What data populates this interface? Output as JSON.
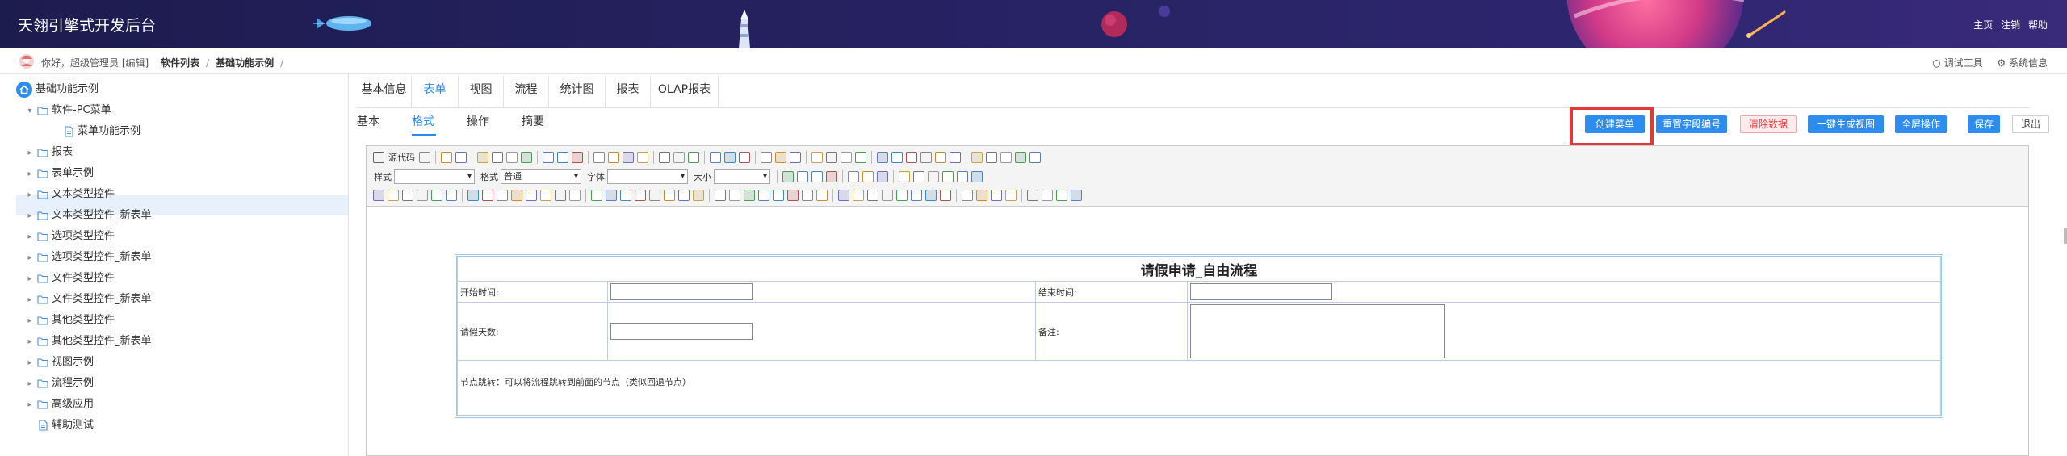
{
  "header": {
    "title": "天翎引擎式开发后台",
    "links": [
      "主页",
      "注销",
      "帮助"
    ]
  },
  "crumb": {
    "greeting": "你好，超级管理员 [编辑]",
    "path": [
      "软件列表",
      "基础功能示例"
    ],
    "sep": "/",
    "right": [
      "调试工具",
      "系统信息"
    ]
  },
  "sidebar": {
    "root": "基础功能示例",
    "items": [
      {
        "label": "软件-PC菜单",
        "icon": "folder-icon",
        "arrow": "▾"
      },
      {
        "label": "菜单功能示例",
        "icon": "file-icon",
        "arrow": ""
      },
      {
        "label": "报表",
        "icon": "folder-icon",
        "arrow": "▸"
      },
      {
        "label": "表单示例",
        "icon": "folder-icon",
        "arrow": "▸"
      },
      {
        "label": "文本类型控件",
        "icon": "folder-icon",
        "arrow": "▸"
      },
      {
        "label": "文本类型控件_新表单",
        "icon": "folder-icon",
        "arrow": "▸"
      },
      {
        "label": "选项类型控件",
        "icon": "folder-icon",
        "arrow": "▸"
      },
      {
        "label": "选项类型控件_新表单",
        "icon": "folder-icon",
        "arrow": "▸"
      },
      {
        "label": "文件类型控件",
        "icon": "folder-icon",
        "arrow": "▸"
      },
      {
        "label": "文件类型控件_新表单",
        "icon": "folder-icon",
        "arrow": "▸"
      },
      {
        "label": "其他类型控件",
        "icon": "folder-icon",
        "arrow": "▸"
      },
      {
        "label": "其他类型控件_新表单",
        "icon": "folder-icon",
        "arrow": "▸"
      },
      {
        "label": "视图示例",
        "icon": "folder-icon",
        "arrow": "▸"
      },
      {
        "label": "流程示例",
        "icon": "folder-icon",
        "arrow": "▸"
      },
      {
        "label": "高级应用",
        "icon": "folder-icon",
        "arrow": "▸"
      },
      {
        "label": "辅助测试",
        "icon": "file-icon",
        "arrow": ""
      }
    ]
  },
  "tabs": [
    "基本信息",
    "表单",
    "视图",
    "流程",
    "统计图",
    "报表",
    "OLAP报表"
  ],
  "subtabs": [
    "基本",
    "格式",
    "操作",
    "摘要"
  ],
  "buttons": {
    "create_menu": "创建菜单",
    "reset_field": "重置字段编号",
    "clear_data": "清除数据",
    "gen_view": "一键生成视图",
    "full_op": "全屏操作",
    "save": "保存",
    "exit": "退出"
  },
  "toolbar": {
    "source": "源代码",
    "style_label": "样式",
    "format_label": "格式",
    "format_value": "普通",
    "font_label": "字体",
    "size_label": "大小"
  },
  "form": {
    "title": "请假申请_自由流程",
    "start_time": "开始时间:",
    "end_time": "结束时间:",
    "days": "请假天数:",
    "remark": "备注:",
    "node_jump": "节点跳转：可以将流程跳转到前面的节点（类似回退节点）"
  },
  "colors": {
    "header_bg": "#24215e",
    "accent": "#2d8cf0",
    "highlight": "#e53935"
  }
}
